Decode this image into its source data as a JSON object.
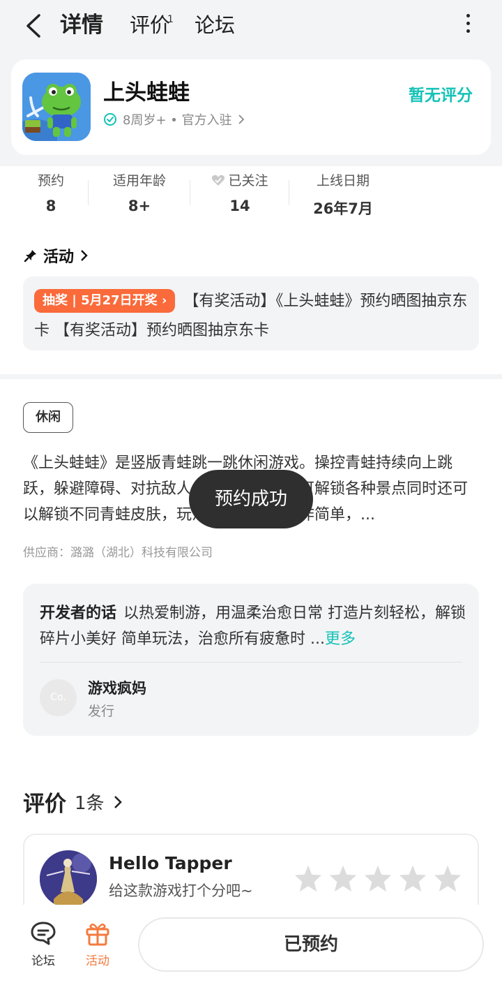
{
  "nav": {
    "tabs": [
      {
        "label": "详情"
      },
      {
        "label": "评价",
        "badge": "1"
      },
      {
        "label": "论坛"
      }
    ]
  },
  "app": {
    "name": "上头蛙蛙",
    "meta": "8周岁+ • 官方入驻",
    "rating_text": "暂无评分"
  },
  "stats": [
    {
      "label": "预约",
      "value": "8"
    },
    {
      "label": "适用年龄",
      "value": "8+"
    },
    {
      "label": "已关注",
      "value": "14"
    },
    {
      "label": "上线日期",
      "value": "26年7月"
    }
  ],
  "activity": {
    "title": "活动",
    "tag": "抽奖 | 5月27日开奖",
    "text": "【有奖活动】《上头蛙蛙》预约晒图抽京东卡 【有奖活动】预约晒图抽京东卡"
  },
  "genre_tag": "休闲",
  "description": "《上头蛙蛙》是竖版青蛙跳一跳休闲游戏。操控青蛙持续向上跳跃，躲避障碍、对抗敌人，闯关升级并即可解锁各种景点同时还可以解锁不同青蛙皮肤，玩法魔性解压、操作简单，...",
  "supplier": "供应商：潞潞（湖北）科技有限公司",
  "toast": "预约成功",
  "developer": {
    "label": "开发者的话",
    "text": "以热爱制游，用温柔治愈日常 打造片刻轻松，解锁碎片小美好 简单玩法，治愈所有疲惫时 ...",
    "more": "更多",
    "avatar_text": "Co.",
    "name": "游戏疯妈",
    "role": "发行"
  },
  "reviews": {
    "title": "评价",
    "count": "1条",
    "user": "Hello Tapper",
    "hint": "给这款游戏打个分吧~",
    "rating": 0,
    "max_rating": 5
  },
  "bottom": {
    "forum": "论坛",
    "activity": "活动",
    "reserve_button": "已预约"
  },
  "colors": {
    "accent": "#14c2b7",
    "lottery": "#fa6a3a",
    "activity_icon": "#f47a3e"
  }
}
